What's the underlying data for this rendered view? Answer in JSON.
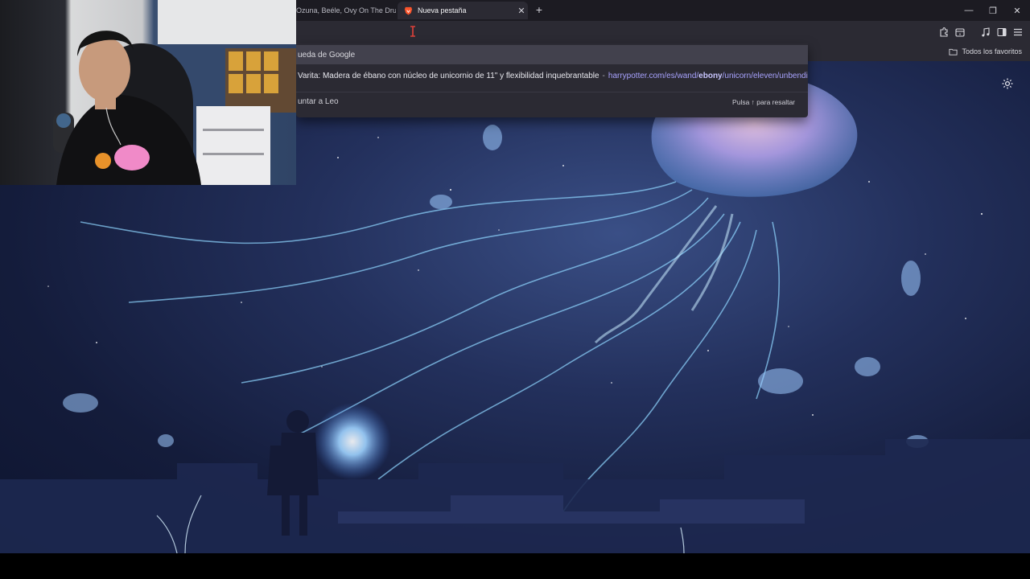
{
  "tabs": [
    {
      "title": "Ozuna, Beéle, Ovy On The Drums",
      "active": false
    },
    {
      "title": "Nueva pestaña",
      "active": true
    }
  ],
  "address_bar": {
    "value": ""
  },
  "toolbar_icons": [
    "extensions-icon",
    "wallet-icon",
    "music-icon",
    "sidebar-icon",
    "menu-icon"
  ],
  "window_controls": {
    "minimize": "—",
    "restore": "❐",
    "close": "✕"
  },
  "new_tab_symbol": "+",
  "tab_close_symbol": "✕",
  "bookmarks": {
    "all_label": "Todos los favoritos"
  },
  "dropdown": {
    "search_row": "ueda de Google",
    "suggestion": {
      "text": "Varita: Madera de ébano con núcleo de unicornio de 11\" y flexibilidad inquebrantable",
      "separator": "-",
      "url_prefix": "harrypotter.com/es/wand/",
      "url_bold": "ebony",
      "url_suffix": "/unicorn/eleven/unbending"
    },
    "leo_row": "untar a Leo",
    "hint": "Pulsa ↑ para resaltar"
  },
  "colors": {
    "chrome": "#2b2a33",
    "tabstrip": "#1c1b22",
    "url_accent": "#a8a3ff",
    "sky": "#23305c"
  }
}
